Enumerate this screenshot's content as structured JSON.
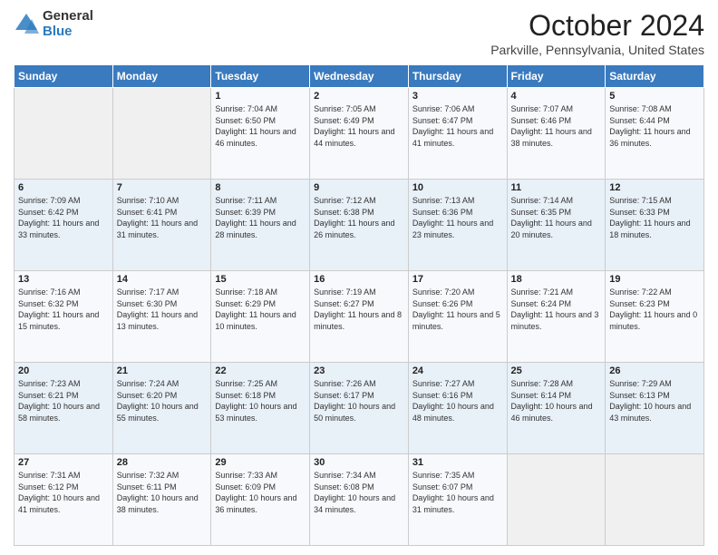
{
  "logo": {
    "general": "General",
    "blue": "Blue"
  },
  "title": "October 2024",
  "location": "Parkville, Pennsylvania, United States",
  "days_of_week": [
    "Sunday",
    "Monday",
    "Tuesday",
    "Wednesday",
    "Thursday",
    "Friday",
    "Saturday"
  ],
  "weeks": [
    [
      {
        "day": "",
        "info": ""
      },
      {
        "day": "",
        "info": ""
      },
      {
        "day": "1",
        "info": "Sunrise: 7:04 AM\nSunset: 6:50 PM\nDaylight: 11 hours and 46 minutes."
      },
      {
        "day": "2",
        "info": "Sunrise: 7:05 AM\nSunset: 6:49 PM\nDaylight: 11 hours and 44 minutes."
      },
      {
        "day": "3",
        "info": "Sunrise: 7:06 AM\nSunset: 6:47 PM\nDaylight: 11 hours and 41 minutes."
      },
      {
        "day": "4",
        "info": "Sunrise: 7:07 AM\nSunset: 6:46 PM\nDaylight: 11 hours and 38 minutes."
      },
      {
        "day": "5",
        "info": "Sunrise: 7:08 AM\nSunset: 6:44 PM\nDaylight: 11 hours and 36 minutes."
      }
    ],
    [
      {
        "day": "6",
        "info": "Sunrise: 7:09 AM\nSunset: 6:42 PM\nDaylight: 11 hours and 33 minutes."
      },
      {
        "day": "7",
        "info": "Sunrise: 7:10 AM\nSunset: 6:41 PM\nDaylight: 11 hours and 31 minutes."
      },
      {
        "day": "8",
        "info": "Sunrise: 7:11 AM\nSunset: 6:39 PM\nDaylight: 11 hours and 28 minutes."
      },
      {
        "day": "9",
        "info": "Sunrise: 7:12 AM\nSunset: 6:38 PM\nDaylight: 11 hours and 26 minutes."
      },
      {
        "day": "10",
        "info": "Sunrise: 7:13 AM\nSunset: 6:36 PM\nDaylight: 11 hours and 23 minutes."
      },
      {
        "day": "11",
        "info": "Sunrise: 7:14 AM\nSunset: 6:35 PM\nDaylight: 11 hours and 20 minutes."
      },
      {
        "day": "12",
        "info": "Sunrise: 7:15 AM\nSunset: 6:33 PM\nDaylight: 11 hours and 18 minutes."
      }
    ],
    [
      {
        "day": "13",
        "info": "Sunrise: 7:16 AM\nSunset: 6:32 PM\nDaylight: 11 hours and 15 minutes."
      },
      {
        "day": "14",
        "info": "Sunrise: 7:17 AM\nSunset: 6:30 PM\nDaylight: 11 hours and 13 minutes."
      },
      {
        "day": "15",
        "info": "Sunrise: 7:18 AM\nSunset: 6:29 PM\nDaylight: 11 hours and 10 minutes."
      },
      {
        "day": "16",
        "info": "Sunrise: 7:19 AM\nSunset: 6:27 PM\nDaylight: 11 hours and 8 minutes."
      },
      {
        "day": "17",
        "info": "Sunrise: 7:20 AM\nSunset: 6:26 PM\nDaylight: 11 hours and 5 minutes."
      },
      {
        "day": "18",
        "info": "Sunrise: 7:21 AM\nSunset: 6:24 PM\nDaylight: 11 hours and 3 minutes."
      },
      {
        "day": "19",
        "info": "Sunrise: 7:22 AM\nSunset: 6:23 PM\nDaylight: 11 hours and 0 minutes."
      }
    ],
    [
      {
        "day": "20",
        "info": "Sunrise: 7:23 AM\nSunset: 6:21 PM\nDaylight: 10 hours and 58 minutes."
      },
      {
        "day": "21",
        "info": "Sunrise: 7:24 AM\nSunset: 6:20 PM\nDaylight: 10 hours and 55 minutes."
      },
      {
        "day": "22",
        "info": "Sunrise: 7:25 AM\nSunset: 6:18 PM\nDaylight: 10 hours and 53 minutes."
      },
      {
        "day": "23",
        "info": "Sunrise: 7:26 AM\nSunset: 6:17 PM\nDaylight: 10 hours and 50 minutes."
      },
      {
        "day": "24",
        "info": "Sunrise: 7:27 AM\nSunset: 6:16 PM\nDaylight: 10 hours and 48 minutes."
      },
      {
        "day": "25",
        "info": "Sunrise: 7:28 AM\nSunset: 6:14 PM\nDaylight: 10 hours and 46 minutes."
      },
      {
        "day": "26",
        "info": "Sunrise: 7:29 AM\nSunset: 6:13 PM\nDaylight: 10 hours and 43 minutes."
      }
    ],
    [
      {
        "day": "27",
        "info": "Sunrise: 7:31 AM\nSunset: 6:12 PM\nDaylight: 10 hours and 41 minutes."
      },
      {
        "day": "28",
        "info": "Sunrise: 7:32 AM\nSunset: 6:11 PM\nDaylight: 10 hours and 38 minutes."
      },
      {
        "day": "29",
        "info": "Sunrise: 7:33 AM\nSunset: 6:09 PM\nDaylight: 10 hours and 36 minutes."
      },
      {
        "day": "30",
        "info": "Sunrise: 7:34 AM\nSunset: 6:08 PM\nDaylight: 10 hours and 34 minutes."
      },
      {
        "day": "31",
        "info": "Sunrise: 7:35 AM\nSunset: 6:07 PM\nDaylight: 10 hours and 31 minutes."
      },
      {
        "day": "",
        "info": ""
      },
      {
        "day": "",
        "info": ""
      }
    ]
  ]
}
